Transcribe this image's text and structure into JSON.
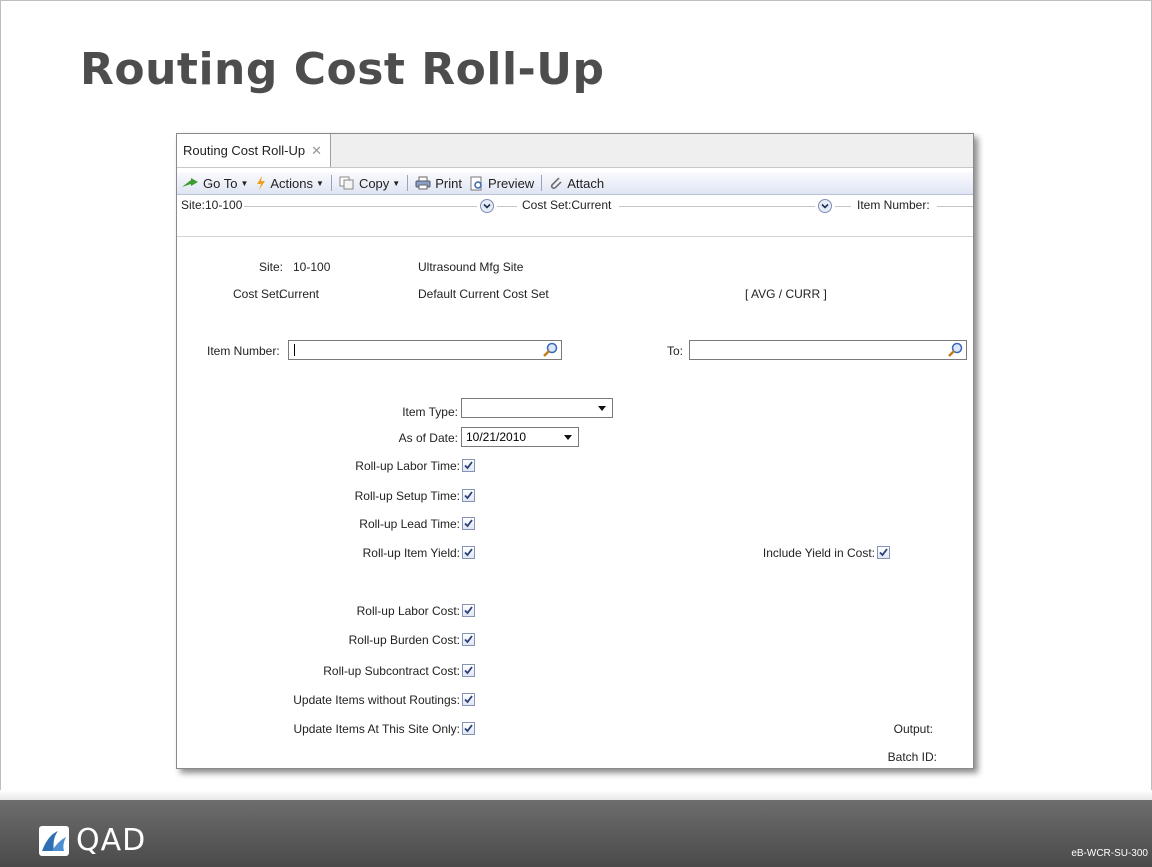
{
  "slide": {
    "title": "Routing Cost Roll-Up",
    "logo_text": "QAD",
    "code": "eB-WCR-SU-300"
  },
  "window": {
    "tab_label": "Routing Cost Roll-Up",
    "toolbar": {
      "goto": "Go To",
      "actions": "Actions",
      "copy": "Copy",
      "print": "Print",
      "preview": "Preview",
      "attach": "Attach"
    },
    "filter": {
      "site": "Site:10-100",
      "cost_set": "Cost Set:Current",
      "item_number": "Item Number:"
    },
    "form": {
      "site_label": "Site:",
      "site_value": "10-100",
      "site_desc": "Ultrasound Mfg Site",
      "cost_set_label": "Cost Set:",
      "cost_set_value": "Current",
      "cost_set_desc": "Default Current Cost Set",
      "cost_method": "[ AVG / CURR ]",
      "item_number_label": "Item Number:",
      "item_number_value": "",
      "to_label": "To:",
      "to_value": "",
      "item_type_label": "Item Type:",
      "item_type_value": "",
      "as_of_date_label": "As of Date:",
      "as_of_date_value": "10/21/2010",
      "rollup_labor_time": "Roll-up Labor Time:",
      "rollup_setup_time": "Roll-up Setup Time:",
      "rollup_lead_time": "Roll-up Lead Time:",
      "rollup_item_yield": "Roll-up Item Yield:",
      "include_yield": "Include Yield in Cost:",
      "rollup_labor_cost": "Roll-up Labor Cost:",
      "rollup_burden_cost": "Roll-up Burden Cost:",
      "rollup_subcontract_cost": "Roll-up Subcontract Cost:",
      "update_without_routings": "Update Items without Routings:",
      "update_this_site": "Update Items At This Site Only:",
      "output_label": "Output:",
      "batch_id_label": "Batch ID:"
    },
    "checkboxes": {
      "rollup_labor_time": true,
      "rollup_setup_time": true,
      "rollup_lead_time": true,
      "rollup_item_yield": true,
      "include_yield": true,
      "rollup_labor_cost": true,
      "rollup_burden_cost": true,
      "rollup_subcontract_cost": true,
      "update_without_routings": true,
      "update_this_site": true
    }
  }
}
